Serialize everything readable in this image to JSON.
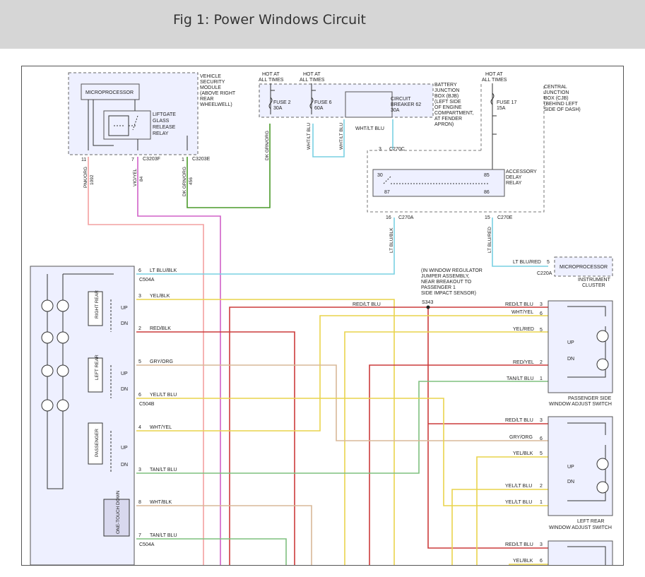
{
  "page": {
    "title": "Fig 1: Power Windows Circuit"
  },
  "colors": {
    "header_bg": "#d6d6d6",
    "box_fill": "#eef0ff",
    "wire_pink": "#f4a0a0",
    "wire_violet": "#d060c8",
    "wire_dkgreen": "#4a9a2a",
    "wire_ltblue": "#79d0e2",
    "wire_yellow": "#e9d44c",
    "wire_red": "#cc3b3b",
    "wire_tan": "#d8b898",
    "wire_green": "#7fc07f"
  },
  "modules": {
    "vsm": {
      "label_lines": [
        "VEHICLE",
        "SECURITY",
        "MODULE",
        "(ABOVE RIGHT",
        "REAR",
        "WHEELWELL)"
      ],
      "microprocessor": "MICROPROCESSOR",
      "relay_lines": [
        "LIFTGATE",
        "GLASS",
        "RELEASE",
        "RELAY"
      ],
      "pins": [
        "11",
        "7",
        "1"
      ],
      "connectors": [
        "C3203F",
        "C3203E"
      ],
      "wire_labels": [
        "PNK/ORG",
        "1092",
        "VIO/YEL",
        "84",
        "DK GRN/ORG",
        "456"
      ]
    },
    "bjb": {
      "hot1": [
        "HOT AT",
        "ALL TIMES"
      ],
      "hot2": [
        "HOT AT",
        "ALL TIMES"
      ],
      "fuse2": [
        "FUSE 2",
        "30A"
      ],
      "fuse6": [
        "FUSE 6",
        "60A"
      ],
      "breaker": [
        "CIRCUIT",
        "BREAKER 62",
        "30A"
      ],
      "label_lines": [
        "BATTERY",
        "JUNCTION",
        "BOX (BJB)",
        "(LEFT SIDE",
        "OF ENGINE",
        "COMPARTMENT,",
        "AT FENDER",
        "APRON)"
      ],
      "wires": [
        "DK GRN/ORG",
        "WHT/LT BLU",
        "WHT/LT BLU",
        "WHT/LT BLU"
      ]
    },
    "cjb": {
      "hot": [
        "HOT AT",
        "ALL TIMES"
      ],
      "fuse17": [
        "FUSE 17",
        "15A"
      ],
      "label_lines": [
        "CENTRAL",
        "JUNCTION",
        "BOX (CJB)",
        "(BEHIND LEFT",
        "SIDE OF DASH)"
      ],
      "top_pin": "3",
      "top_conn": "C270C",
      "relay_lines": [
        "ACCESSORY",
        "DELAY",
        "RELAY"
      ],
      "relay_pins": [
        "30",
        "87",
        "85",
        "86"
      ],
      "bottom_pins": [
        "16",
        "15"
      ],
      "bottom_conns": [
        "C270A",
        "C270E"
      ],
      "bottom_wires": [
        "LT BLU/BLK",
        "LT BLU/RED"
      ]
    },
    "ic": {
      "wire": "LT BLU/RED",
      "pin": "5",
      "conn": "C220A",
      "microprocessor": "MICROPROCESSOR",
      "label_lines": [
        "INSTRUMENT",
        "CLUSTER"
      ]
    },
    "s343": {
      "note_lines": [
        "(IN WINDOW REGULATOR",
        "JUMPER ASSEMBLY,",
        "NEAR BREAKOUT TO",
        "PASSENGER 1",
        "SIDE IMPACT SENSOR)"
      ],
      "label": "S343",
      "wire": "RED/LT BLU"
    },
    "master": {
      "switches": [
        "RIGHT REAR",
        "LEFT REAR",
        "PASSENGER",
        "ONE-TOUCH DOWN"
      ],
      "up": "UP",
      "dn": "DN",
      "pins": [
        {
          "pin": "6",
          "wire": "LT BLU/BLK"
        },
        {
          "pin": "3",
          "wire": "YEL/BLK"
        },
        {
          "pin": "2",
          "wire": "RED/BLK"
        },
        {
          "pin": "5",
          "wire": "GRY/ORG"
        },
        {
          "pin": "6",
          "wire": "YEL/LT BLU"
        },
        {
          "pin": "4",
          "wire": "WHT/YEL"
        },
        {
          "pin": "3",
          "wire": "TAN/LT BLU"
        },
        {
          "pin": "8",
          "wire": "WHT/BLK"
        },
        {
          "pin": "7",
          "wire": "TAN/LT BLU"
        }
      ],
      "connectors": [
        "C504A",
        "C504B",
        "C504A"
      ]
    },
    "psw": {
      "pins": [
        {
          "wire": "RED/LT BLU",
          "pin": "3"
        },
        {
          "wire": "WHT/YEL",
          "pin": "6"
        },
        {
          "wire": "YEL/RED",
          "pin": "5"
        },
        {
          "wire": "RED/YEL",
          "pin": "2"
        },
        {
          "wire": "TAN/LT BLU",
          "pin": "1"
        }
      ],
      "label_lines": [
        "PASSENGER SIDE",
        "WINDOW ADJUST SWITCH"
      ]
    },
    "lrsw": {
      "pins": [
        {
          "wire": "RED/LT BLU",
          "pin": "3"
        },
        {
          "wire": "GRY/ORG",
          "pin": "6"
        },
        {
          "wire": "YEL/BLK",
          "pin": "5"
        },
        {
          "wire": "YEL/LT BLU",
          "pin": "2"
        },
        {
          "wire": "YEL/LT BLU",
          "pin": "1"
        }
      ],
      "label_lines": [
        "LEFT REAR",
        "WINDOW ADJUST SWITCH"
      ]
    },
    "rrsw": {
      "pins": [
        {
          "wire": "RED/LT BLU",
          "pin": "3"
        },
        {
          "wire": "YEL/BLK",
          "pin": "6"
        }
      ]
    }
  }
}
